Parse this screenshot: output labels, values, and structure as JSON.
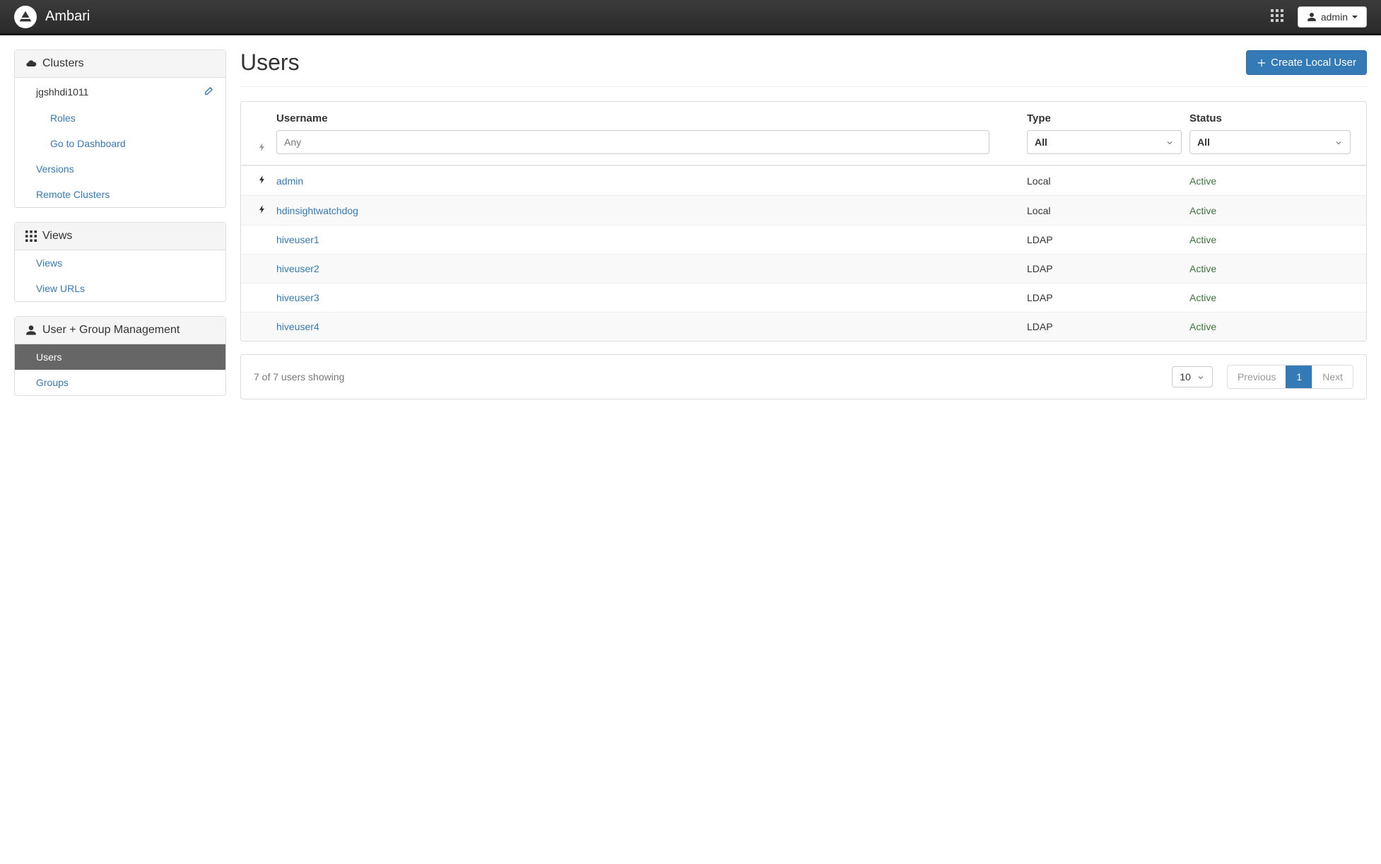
{
  "navbar": {
    "brand": "Ambari",
    "user_label": "admin"
  },
  "sidebar": {
    "clusters": {
      "heading": "Clusters",
      "cluster_name": "jgshhdi1011",
      "roles_label": "Roles",
      "dashboard_label": "Go to Dashboard",
      "versions_label": "Versions",
      "remote_label": "Remote Clusters"
    },
    "views": {
      "heading": "Views",
      "views_label": "Views",
      "urls_label": "View URLs"
    },
    "usermgmt": {
      "heading": "User + Group Management",
      "users_label": "Users",
      "groups_label": "Groups"
    }
  },
  "page": {
    "title": "Users",
    "create_button": "Create Local User"
  },
  "table": {
    "headers": {
      "username": "Username",
      "type": "Type",
      "status": "Status"
    },
    "filters": {
      "username_placeholder": "Any",
      "type_value": "All",
      "status_value": "All"
    },
    "rows": [
      {
        "admin_icon": true,
        "username": "admin",
        "type": "Local",
        "status": "Active"
      },
      {
        "admin_icon": true,
        "username": "hdinsightwatchdog",
        "type": "Local",
        "status": "Active"
      },
      {
        "admin_icon": false,
        "username": "hiveuser1",
        "type": "LDAP",
        "status": "Active"
      },
      {
        "admin_icon": false,
        "username": "hiveuser2",
        "type": "LDAP",
        "status": "Active"
      },
      {
        "admin_icon": false,
        "username": "hiveuser3",
        "type": "LDAP",
        "status": "Active"
      },
      {
        "admin_icon": false,
        "username": "hiveuser4",
        "type": "LDAP",
        "status": "Active"
      }
    ]
  },
  "footer": {
    "status_text": "7 of 7 users showing",
    "page_size": "10",
    "prev_label": "Previous",
    "page_num": "1",
    "next_label": "Next"
  }
}
